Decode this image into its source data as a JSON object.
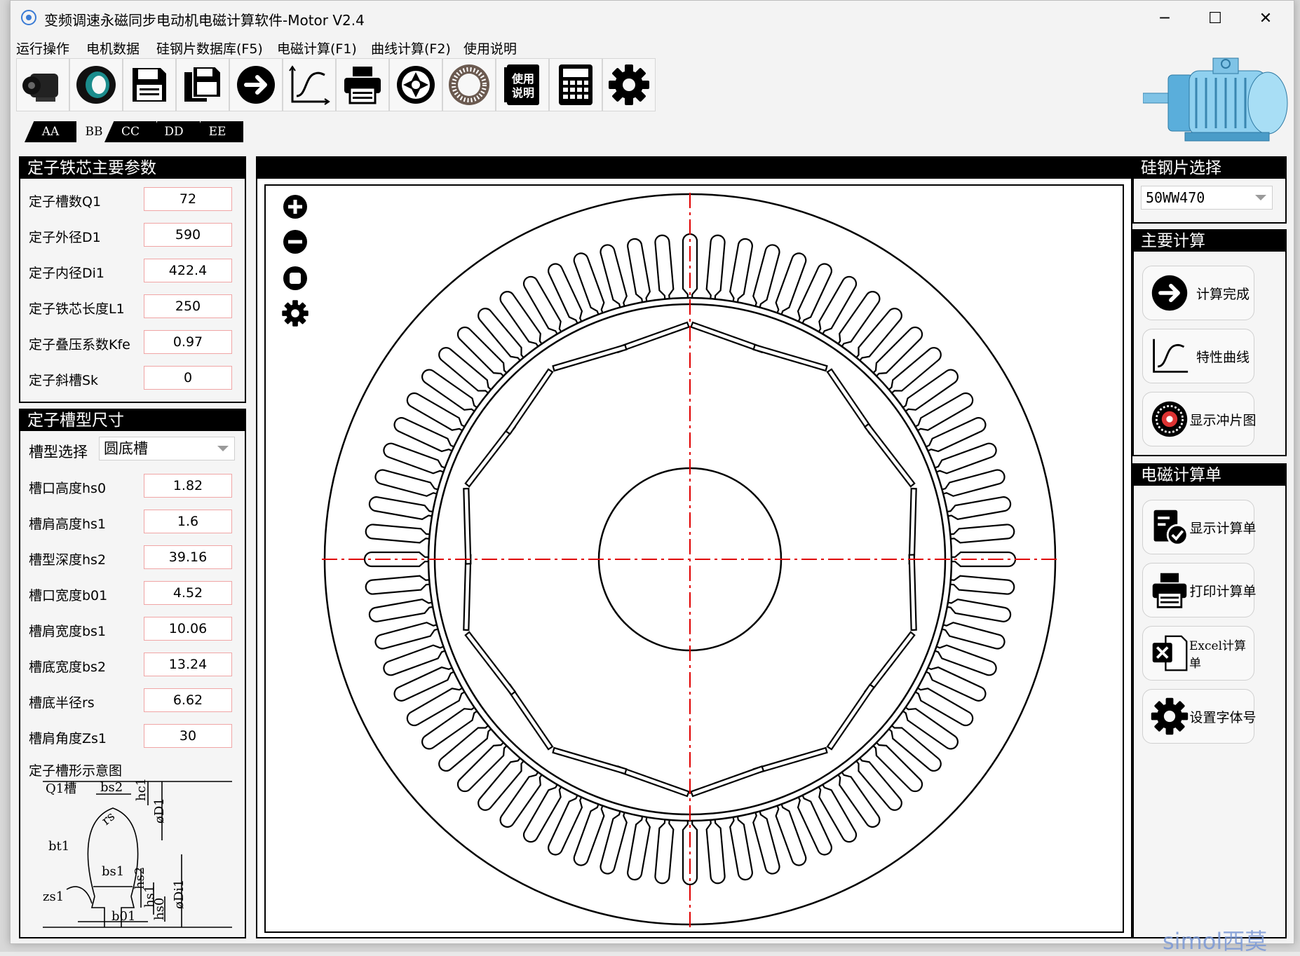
{
  "window": {
    "title": "变频调速永磁同步电动机电磁计算软件-Motor V2.4",
    "minimize": "─",
    "maximize": "☐",
    "close": "✕"
  },
  "menu": [
    "运行操作",
    "电机数据",
    "硅钢片数据库(F5)",
    "电磁计算(F1)",
    "曲线计算(F2)",
    "使用说明"
  ],
  "toolbar": {
    "icons": [
      "motor-icon",
      "stator-ring-icon",
      "save-icon",
      "save-as-icon",
      "arrow-right-icon",
      "curve-icon",
      "printer-icon",
      "punch-sheet-icon",
      "lamination-icon",
      "manual-icon",
      "calculator-icon",
      "gear-icon"
    ],
    "manual_text": "使用说明"
  },
  "tabs": [
    "AA",
    "BB",
    "CC",
    "DD",
    "EE"
  ],
  "active_tab": "BB",
  "stator_core": {
    "title": "定子铁芯主要参数",
    "rows": [
      {
        "label": "定子槽数Q1",
        "value": "72"
      },
      {
        "label": "定子外径D1",
        "value": "590"
      },
      {
        "label": "定子内径Di1",
        "value": "422.4"
      },
      {
        "label": "定子铁芯长度L1",
        "value": "250"
      },
      {
        "label": "定子叠压系数Kfe",
        "value": "0.97"
      },
      {
        "label": "定子斜槽Sk",
        "value": "0"
      }
    ]
  },
  "slot": {
    "title": "定子槽型尺寸",
    "type_label": "槽型选择",
    "type_value": "圆底槽",
    "rows": [
      {
        "label": "槽口高度hs0",
        "value": "1.82"
      },
      {
        "label": "槽肩高度hs1",
        "value": "1.6"
      },
      {
        "label": "槽型深度hs2",
        "value": "39.16"
      },
      {
        "label": "槽口宽度b01",
        "value": "4.52"
      },
      {
        "label": "槽肩宽度bs1",
        "value": "10.06"
      },
      {
        "label": "槽底宽度bs2",
        "value": "13.24"
      },
      {
        "label": "槽底半径rs",
        "value": "6.62"
      },
      {
        "label": "槽肩角度Zs1",
        "value": "30"
      }
    ],
    "diagram_title": "定子槽形示意图",
    "diagram_labels": {
      "q1": "Q1槽",
      "bs2": "bs2",
      "hc1": "hc1",
      "rs": "rs",
      "d1": "øD1",
      "bt1": "bt1",
      "bs1": "bs1",
      "hs2": "hs2",
      "hs1": "hs1",
      "hs0": "hs0",
      "zs1": "zs1",
      "b01": "b01",
      "di1": "øDi1"
    }
  },
  "drawing": {
    "stator_slots": 72,
    "rotor_poles": 10,
    "center_line_color": "#e00000"
  },
  "steel": {
    "title": "硅钢片选择",
    "value": "50WW470"
  },
  "main_calc": {
    "title": "主要计算",
    "buttons": [
      {
        "icon": "arrow-right-icon",
        "label": "计算完成"
      },
      {
        "icon": "curve-icon",
        "label": "特性曲线"
      },
      {
        "icon": "punch-sheet-icon",
        "label": "显示冲片图"
      }
    ]
  },
  "em_sheet": {
    "title": "电磁计算单",
    "buttons": [
      {
        "icon": "document-check-icon",
        "label": "显示计算单"
      },
      {
        "icon": "printer-icon",
        "label": "打印计算单"
      },
      {
        "icon": "excel-icon",
        "label": "Excel计算单"
      },
      {
        "icon": "gear-icon",
        "label": "设置字体号"
      }
    ]
  },
  "watermark": "simol西莫"
}
